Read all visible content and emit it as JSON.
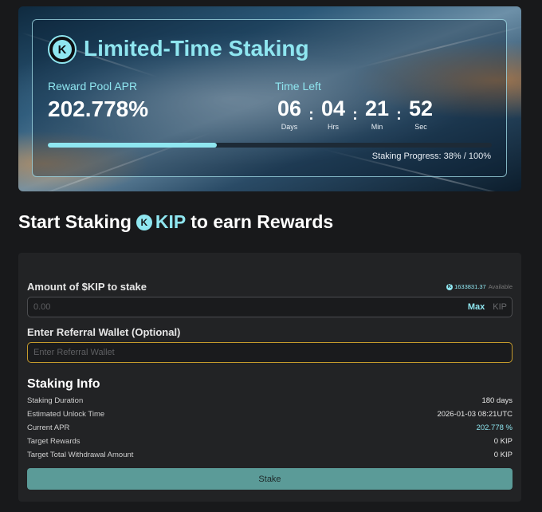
{
  "banner": {
    "title": "Limited-Time Staking",
    "logo_letter": "K",
    "apr_label": "Reward Pool APR",
    "apr_value": "202.778%",
    "time_label": "Time Left",
    "countdown": [
      {
        "value": "06",
        "unit": "Days"
      },
      {
        "value": "04",
        "unit": "Hrs"
      },
      {
        "value": "21",
        "unit": "Min"
      },
      {
        "value": "52",
        "unit": "Sec"
      }
    ],
    "separator": ":",
    "progress_fraction": 0.38,
    "progress_text": "Staking Progress: 38% / 100%"
  },
  "heading": {
    "prefix": "Start Staking",
    "token_logo_letter": "K",
    "token": "KIP",
    "suffix": "to earn Rewards"
  },
  "form": {
    "amount_label": "Amount of $KIP to stake",
    "balance_value": "1633831.37",
    "balance_suffix": "Available",
    "amount_placeholder": "0.00",
    "max_label": "Max",
    "unit_label": "KIP",
    "referral_label": "Enter Referral Wallet (Optional)",
    "referral_placeholder": "Enter Referral Wallet"
  },
  "info": {
    "title": "Staking Info",
    "rows": [
      {
        "label": "Staking Duration",
        "value": "180 days"
      },
      {
        "label": "Estimated Unlock Time",
        "value": "2026-01-03 08:21UTC"
      },
      {
        "label": "Current APR",
        "value": "202.778 %"
      },
      {
        "label": "Target Rewards",
        "value": "0 KIP"
      },
      {
        "label": "Target Total Withdrawal Amount",
        "value": "0 KIP"
      }
    ]
  },
  "stake_button": "Stake",
  "colors": {
    "accent": "#8fe6f0",
    "button": "#5b9b98",
    "referral_border": "#c49a2c",
    "background": "#18191b",
    "panel": "#222325"
  }
}
